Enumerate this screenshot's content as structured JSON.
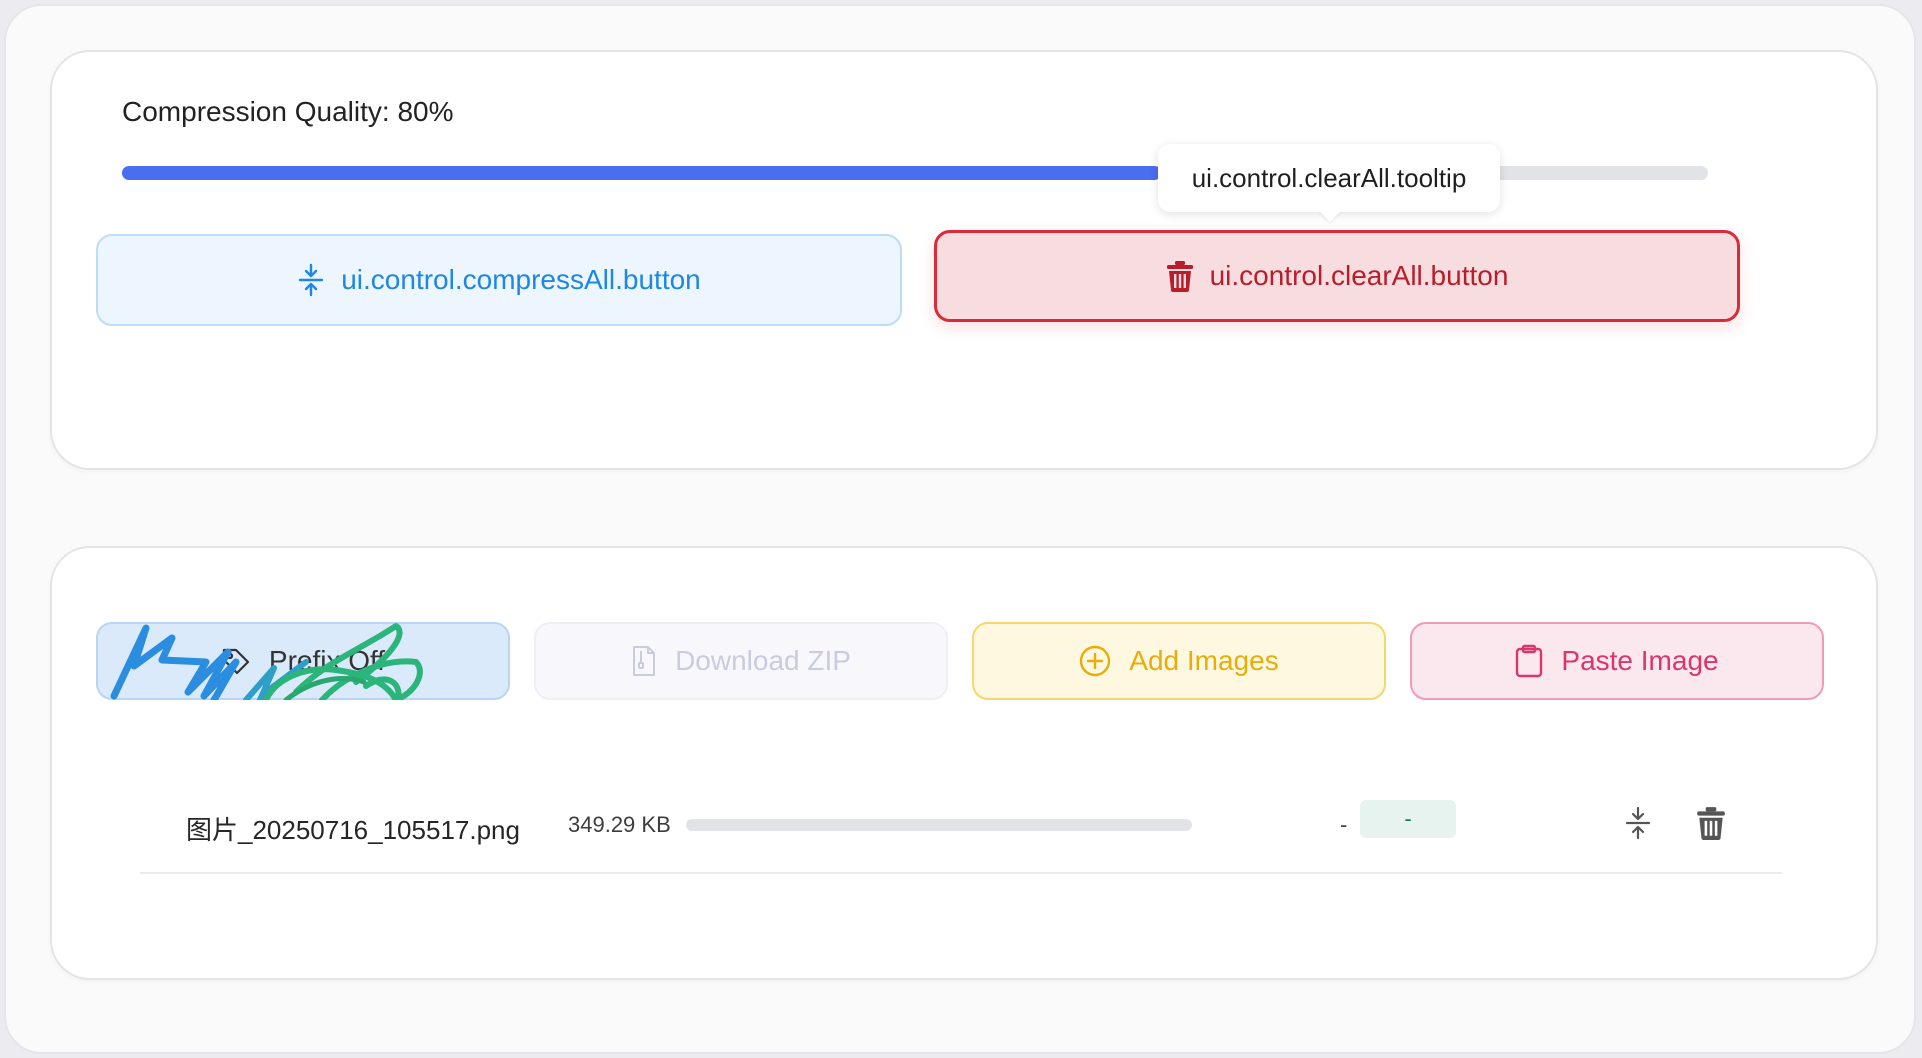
{
  "controls": {
    "quality_label": "Compression Quality:",
    "quality_value": "80%",
    "quality_fraction": 0.655,
    "compress_all_label": "ui.control.compressAll.button",
    "clear_all_label": "ui.control.clearAll.button",
    "clear_all_tooltip": "ui.control.clearAll.tooltip"
  },
  "toolbar": {
    "prefix_label": "Prefix Off",
    "download_zip_label": "Download ZIP",
    "add_images_label": "Add Images",
    "paste_image_label": "Paste Image"
  },
  "files": [
    {
      "name": "图片_20250716_105517.png",
      "size": "349.29 KB",
      "progress": 0,
      "result_size": "-",
      "saved": "-"
    }
  ],
  "colors": {
    "accent": "#4a6ef0",
    "compress": "#1d87e4",
    "danger": "#d92b3a",
    "add": "#e8ad09",
    "paste": "#d9366c"
  },
  "icons": {
    "compress": "compress-icon",
    "trash": "trash-icon",
    "prefix": "tag-icon",
    "zip": "file-zip-icon",
    "add": "plus-circle-icon",
    "paste": "clipboard-icon"
  }
}
